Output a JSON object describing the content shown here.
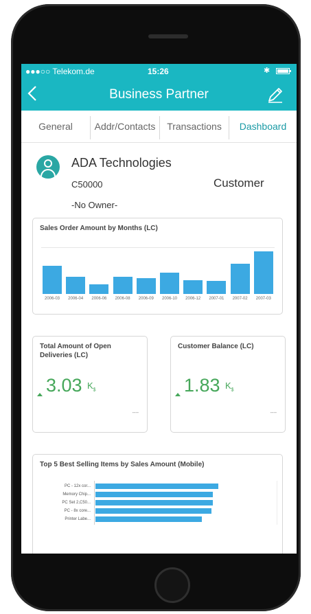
{
  "status_bar": {
    "carrier": "●●●○○ Telekom.de",
    "time": "15:26",
    "bluetooth_icon": "bluetooth-icon",
    "battery_icon": "battery-icon"
  },
  "nav": {
    "back_icon": "chevron-left-icon",
    "title": "Business Partner",
    "edit_icon": "pencil-icon"
  },
  "tabs": [
    {
      "label": "General",
      "active": false
    },
    {
      "label": "Addr/Contacts",
      "active": false
    },
    {
      "label": "Transactions",
      "active": false
    },
    {
      "label": "Dashboard",
      "active": true
    }
  ],
  "partner": {
    "name": "ADA Technologies",
    "code": "C50000",
    "type": "Customer",
    "owner": "-No Owner-",
    "avatar_icon": "person-icon"
  },
  "sales_chart": {
    "title": "Sales Order Amount by Months (LC)",
    "chart_data": {
      "type": "bar",
      "categories": [
        "2006-03",
        "2006-04",
        "2006-06",
        "2006-08",
        "2006-09",
        "2006-10",
        "2006-12",
        "2007-01",
        "2007-02",
        "2007-03"
      ],
      "values": [
        42,
        25,
        14,
        25,
        23,
        31,
        20,
        19,
        45,
        63
      ],
      "ylim": [
        0,
        80
      ],
      "grid": false
    }
  },
  "kpis": [
    {
      "title": "Total Amount of Open Deliveries (LC)",
      "value": "3.03",
      "unit": "K",
      "currency": "$",
      "trend": "up",
      "footer": "----"
    },
    {
      "title": "Customer Balance (LC)",
      "value": "1.83",
      "unit": "K",
      "currency": "$",
      "trend": "up",
      "footer": "----"
    }
  ],
  "top_items": {
    "title": "Top 5 Best Selling Items by Sales Amount (Mobile)",
    "chart_data": {
      "type": "bar",
      "orientation": "horizontal",
      "categories": [
        "PC - 12x cor...",
        "Memory Chip...",
        "PC Set 2,C50...",
        "PC - 8x core...",
        "Printer Labe..."
      ],
      "values": [
        188,
        180,
        180,
        178,
        163
      ],
      "xlim": [
        0,
        200
      ]
    }
  },
  "colors": {
    "brand": "#1ab7c2",
    "bar": "#3ca9e2",
    "positive": "#46a75a",
    "active_tab": "#1a9aa5"
  }
}
